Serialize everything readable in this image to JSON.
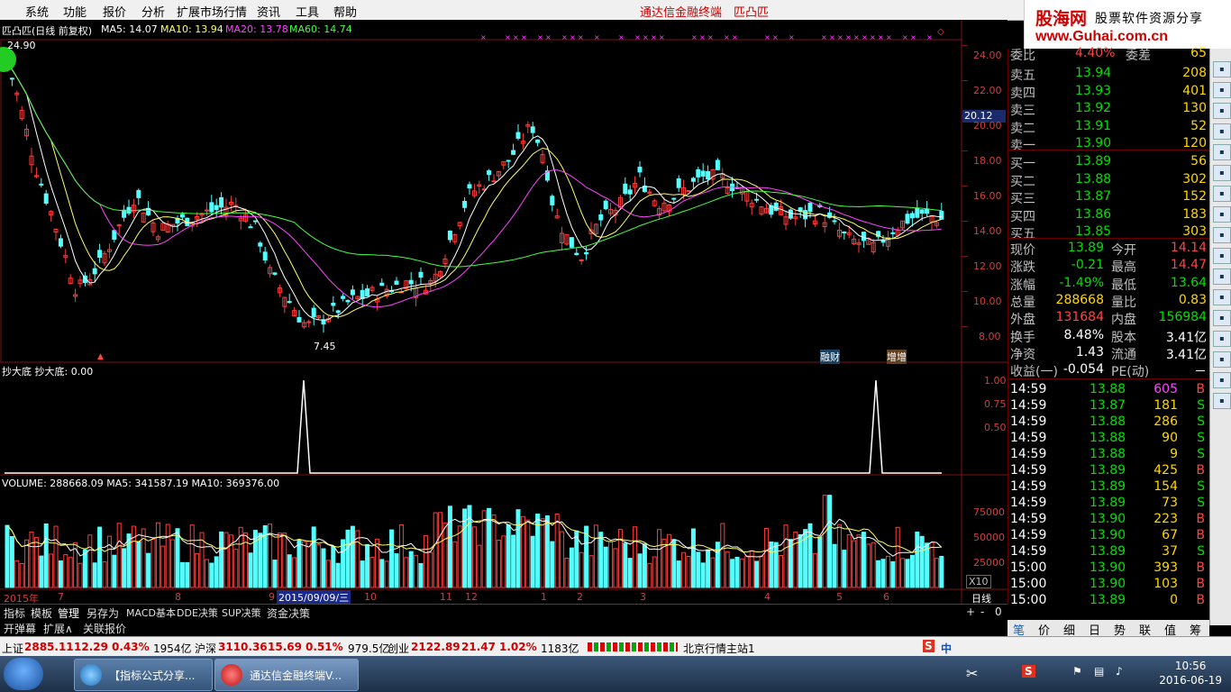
{
  "menu": [
    "系统",
    "功能",
    "报价",
    "分析",
    "扩展市场行情",
    "资讯",
    "工具",
    "帮助"
  ],
  "app_title": "通达信金融终端　匹凸匹",
  "banner": {
    "logo": "股海网",
    "slogan": "股票软件资源分享",
    "url": "www.Guhai.com.cn"
  },
  "chart": {
    "header": {
      "name": "匹凸匹(日线 前复权)",
      "ma5": "MA5: 14.07",
      "ma10": "MA10: 13.94",
      "ma20": "MA20: 13.78",
      "ma60": "MA60: 14.74"
    },
    "high_mark": "24.90",
    "low_mark": "7.45",
    "price_axis": [
      "24.00",
      "22.00",
      "20.00",
      "18.00",
      "16.00",
      "14.00",
      "12.00",
      "10.00",
      "8.00"
    ],
    "cursor_price": "20.12",
    "event_tags": [
      "融财",
      "增增"
    ],
    "indicator_title": "抄大底  抄大底: 0.00",
    "indicator_axis": [
      "1.00",
      "0.75",
      "0.50"
    ],
    "volume_title": "VOLUME: 288668.09  MA5: 341587.19  MA10: 369376.00",
    "volume_axis": [
      "75000",
      "50000",
      "25000"
    ],
    "volume_unit": "X10",
    "date_axis": [
      "2015年",
      "7",
      "8",
      "9",
      "2015/09/09/三",
      "10",
      "11",
      "12",
      "1",
      "2",
      "3",
      "4",
      "5",
      "6"
    ],
    "period": "日线",
    "colors": {
      "up": "#ff3c3c",
      "down": "#54ffff",
      "ma5": "#ffffff",
      "ma10": "#ffff66",
      "ma20": "#ff44ff",
      "ma60": "#44ff44"
    }
  },
  "quote": {
    "webi": {
      "label": "委比",
      "value": "4.40%",
      "label2": "委差",
      "value2": "65"
    },
    "sell": [
      {
        "label": "卖五",
        "price": "13.94",
        "vol": "208"
      },
      {
        "label": "卖四",
        "price": "13.93",
        "vol": "401"
      },
      {
        "label": "卖三",
        "price": "13.92",
        "vol": "130"
      },
      {
        "label": "卖二",
        "price": "13.91",
        "vol": "52"
      },
      {
        "label": "卖一",
        "price": "13.90",
        "vol": "120"
      }
    ],
    "buy": [
      {
        "label": "买一",
        "price": "13.89",
        "vol": "56"
      },
      {
        "label": "买二",
        "price": "13.88",
        "vol": "302"
      },
      {
        "label": "买三",
        "price": "13.87",
        "vol": "152"
      },
      {
        "label": "买四",
        "price": "13.86",
        "vol": "183"
      },
      {
        "label": "买五",
        "price": "13.85",
        "vol": "303"
      }
    ],
    "stats": [
      {
        "l1": "现价",
        "v1": "13.89",
        "c1": "grn",
        "l2": "今开",
        "v2": "14.14",
        "c2": "red"
      },
      {
        "l1": "涨跌",
        "v1": "-0.21",
        "c1": "grn",
        "l2": "最高",
        "v2": "14.47",
        "c2": "red"
      },
      {
        "l1": "涨幅",
        "v1": "-1.49%",
        "c1": "grn",
        "l2": "最低",
        "v2": "13.64",
        "c2": "grn"
      },
      {
        "l1": "总量",
        "v1": "288668",
        "c1": "yel",
        "l2": "量比",
        "v2": "0.83",
        "c2": "yel"
      },
      {
        "l1": "外盘",
        "v1": "131684",
        "c1": "red",
        "l2": "内盘",
        "v2": "156984",
        "c2": "grn"
      },
      {
        "l1": "换手",
        "v1": "8.48%",
        "c1": "wht",
        "l2": "股本",
        "v2": "3.41亿",
        "c2": "wht"
      },
      {
        "l1": "净资",
        "v1": "1.43",
        "c1": "wht",
        "l2": "流通",
        "v2": "3.41亿",
        "c2": "wht"
      },
      {
        "l1": "收益(一)",
        "v1": "-0.054",
        "c1": "wht",
        "l2": "PE(动)",
        "v2": "－",
        "c2": "wht"
      }
    ],
    "ticks": [
      {
        "t": "14:59",
        "p": "13.88",
        "v": "605",
        "s": "B"
      },
      {
        "t": "14:59",
        "p": "13.87",
        "v": "181",
        "s": "S"
      },
      {
        "t": "14:59",
        "p": "13.88",
        "v": "286",
        "s": "S"
      },
      {
        "t": "14:59",
        "p": "13.88",
        "v": "90",
        "s": "S"
      },
      {
        "t": "14:59",
        "p": "13.88",
        "v": "9",
        "s": "S"
      },
      {
        "t": "14:59",
        "p": "13.89",
        "v": "425",
        "s": "B"
      },
      {
        "t": "14:59",
        "p": "13.89",
        "v": "154",
        "s": "S"
      },
      {
        "t": "14:59",
        "p": "13.89",
        "v": "73",
        "s": "S"
      },
      {
        "t": "14:59",
        "p": "13.90",
        "v": "223",
        "s": "B"
      },
      {
        "t": "14:59",
        "p": "13.90",
        "v": "67",
        "s": "B"
      },
      {
        "t": "14:59",
        "p": "13.89",
        "v": "37",
        "s": "S"
      },
      {
        "t": "15:00",
        "p": "13.90",
        "v": "393",
        "s": "B"
      },
      {
        "t": "15:00",
        "p": "13.90",
        "v": "103",
        "s": "B"
      },
      {
        "t": "15:00",
        "p": "13.89",
        "v": "0",
        "s": "B"
      }
    ]
  },
  "tabs_row1": [
    "指标",
    "模板",
    "管理",
    "另存为",
    "MACD基本",
    "DDE决策",
    "SUP决策",
    "资金决策"
  ],
  "tabs_row2": [
    "开弹幕",
    "扩展∧",
    "关联报价"
  ],
  "right_tabs": [
    "笔",
    "价",
    "细",
    "日",
    "势",
    "联",
    "值",
    "筹"
  ],
  "status": {
    "sh_label": "上证",
    "sh_val": "2885.11",
    "sh_chg": "12.29",
    "sh_pct": "0.43%",
    "sh_amt": "1954亿",
    "hs_label": "沪深",
    "hs_val": "3110.36",
    "hs_chg": "15.69",
    "hs_pct": "0.51%",
    "hs_amt": "979.5亿",
    "cy_label": "创业",
    "cy_val": "2122.89",
    "cy_chg": "21.47",
    "cy_pct": "1.02%",
    "cy_amt": "1183亿",
    "server": "北京行情主站1"
  },
  "taskbar": {
    "tasks": [
      "【指标公式分享...",
      "通达信金融终端V..."
    ],
    "time": "10:56",
    "date": "2016-06-19"
  },
  "side_icons": [
    "up-arrow-icon",
    "chart-icon",
    "list-icon",
    "kline-icon",
    "trend-icon",
    "f10-icon",
    "info-icon",
    "fe-icon",
    "fa-icon",
    "ff-icon",
    "macd-icon",
    "rsi-icon",
    "zoom-icon",
    "move-icon",
    "f3-icon",
    "f5-icon",
    "f6-icon"
  ]
}
